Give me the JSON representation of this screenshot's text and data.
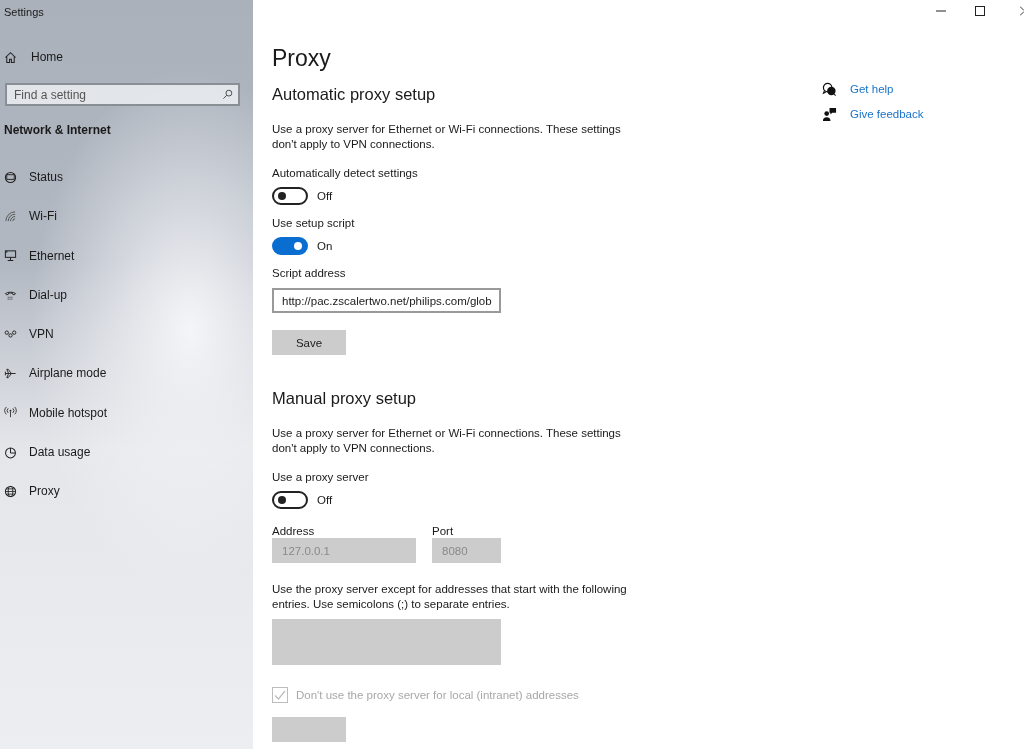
{
  "window": {
    "title": "Settings"
  },
  "sidebar": {
    "home": "Home",
    "search": {
      "placeholder": "Find a setting"
    },
    "group": "Network & Internet",
    "items": [
      {
        "label": "Status"
      },
      {
        "label": "Wi-Fi"
      },
      {
        "label": "Ethernet"
      },
      {
        "label": "Dial-up"
      },
      {
        "label": "VPN"
      },
      {
        "label": "Airplane mode"
      },
      {
        "label": "Mobile hotspot"
      },
      {
        "label": "Data usage"
      },
      {
        "label": "Proxy"
      }
    ]
  },
  "page": {
    "title": "Proxy",
    "automatic": {
      "heading": "Automatic proxy setup",
      "description": "Use a proxy server for Ethernet or Wi-Fi connections. These settings don't apply to VPN connections.",
      "detect": {
        "label": "Automatically detect settings",
        "on": false,
        "state_text": "Off"
      },
      "script": {
        "label": "Use setup script",
        "on": true,
        "state_text": "On"
      },
      "address": {
        "label": "Script address",
        "value": "http://pac.zscalertwo.net/philips.com/glob"
      },
      "save": "Save"
    },
    "manual": {
      "heading": "Manual proxy setup",
      "description": "Use a proxy server for Ethernet or Wi-Fi connections. These settings don't apply to VPN connections.",
      "use_proxy": {
        "label": "Use a proxy server",
        "on": false,
        "state_text": "Off"
      },
      "address": {
        "label": "Address",
        "value": "127.0.0.1",
        "disabled": true
      },
      "port": {
        "label": "Port",
        "value": "8080",
        "disabled": true
      },
      "exceptions": {
        "description": "Use the proxy server except for addresses that start with the following entries. Use semicolons (;) to separate entries.",
        "disabled": true
      },
      "bypass_local": {
        "label": "Don't use the proxy server for local (intranet) addresses",
        "checked": true,
        "disabled": true
      }
    }
  },
  "help": {
    "links": [
      {
        "label": "Get help"
      },
      {
        "label": "Give feedback"
      }
    ]
  }
}
